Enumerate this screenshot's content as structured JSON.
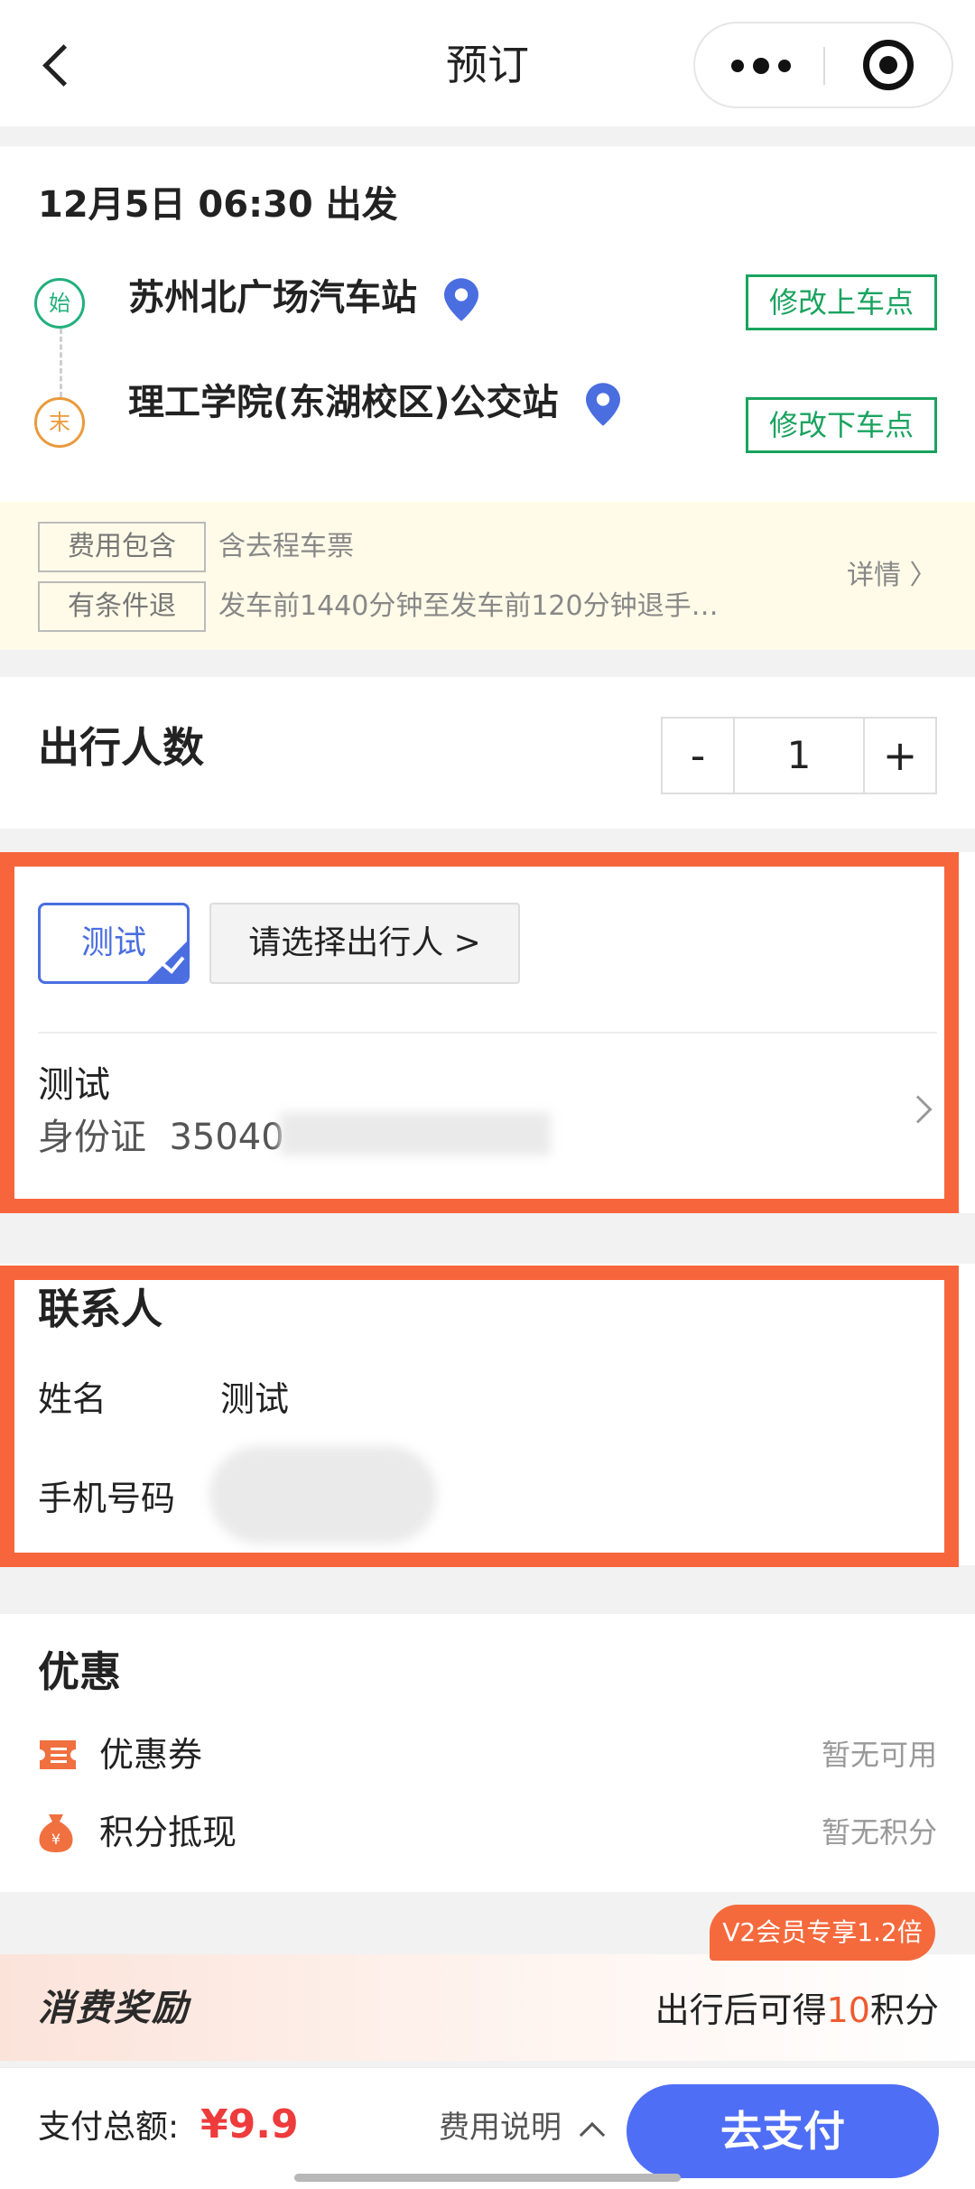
{
  "nav": {
    "title": "预订"
  },
  "trip": {
    "datetime": "12月5日 06:30 出发",
    "start_badge": "始",
    "end_badge": "末",
    "start_station": "苏州北广场汽车站",
    "end_station": "理工学院(东湖校区)公交站",
    "change_pickup": "修改上车点",
    "change_dropoff": "修改下车点"
  },
  "policy": {
    "tag1": "费用包含",
    "text1": "含去程车票",
    "tag2": "有条件退",
    "text2": "发车前1440分钟至发车前120分钟退手…",
    "detail": "详情"
  },
  "travelers": {
    "title": "出行人数",
    "count": "1",
    "minus": "-",
    "plus": "+"
  },
  "passenger": {
    "selected_chip": "测试",
    "choose": "请选择出行人 >",
    "name": "测试",
    "id_label": "身份证",
    "id_prefix": "35040"
  },
  "contact": {
    "title": "联系人",
    "name_label": "姓名",
    "name_value": "测试",
    "phone_label": "手机号码"
  },
  "offers": {
    "title": "优惠",
    "coupon_label": "优惠券",
    "coupon_value": "暂无可用",
    "points_label": "积分抵现",
    "points_value": "暂无积分"
  },
  "reward": {
    "logo": "消费奖励",
    "vip": "V2会员专享1.2倍",
    "text_before": "出行后可得",
    "points": "10",
    "text_after": "积分"
  },
  "bottom": {
    "total_label": "支付总额:",
    "total_amount": "¥9.9",
    "fee_explain": "费用说明",
    "pay": "去支付"
  },
  "colors": {
    "green": "#1aa35f",
    "orange_highlight": "#f7653d",
    "blue_primary": "#4f6ef6",
    "price_red": "#ee3b3b"
  }
}
